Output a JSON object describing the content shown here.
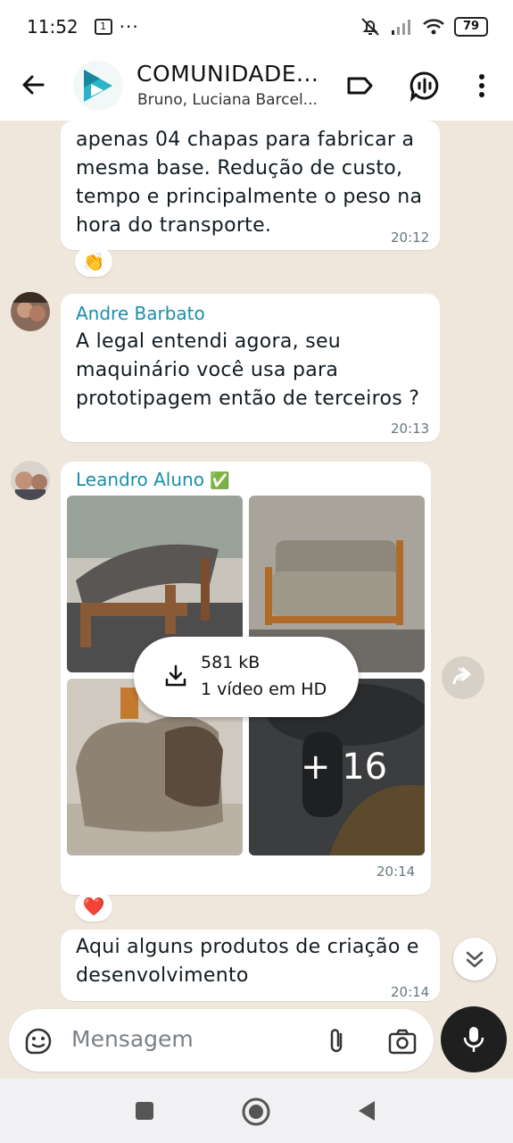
{
  "status_bar": {
    "time": "11:52",
    "notif_count": "1",
    "more": "···",
    "battery": "79"
  },
  "header": {
    "title": "COMUNIDADE...",
    "subtitle": "Bruno, Luciana Barcel..."
  },
  "messages": [
    {
      "text_lines": [
        "apenas 04 chapas para fabricar a",
        "mesma base. Redução de custo,",
        "tempo e principalmente o peso na",
        "hora do transporte."
      ],
      "time": "20:12",
      "reaction": "👏"
    },
    {
      "sender": "Andre Barbato",
      "text_lines": [
        "A legal entendi agora, seu",
        "maquinário você usa para",
        "prototipagem então de terceiros ?"
      ],
      "time": "20:13"
    },
    {
      "sender": "Leandro Aluno",
      "sender_badge": "✅",
      "media": {
        "download_size": "581 kB",
        "download_label": "1 vídeo em HD",
        "more_count": "+ 16"
      },
      "time": "20:14",
      "reaction": "❤️"
    },
    {
      "text_lines": [
        "Aqui alguns produtos de criação e",
        "desenvolvimento"
      ],
      "time": "20:14"
    }
  ],
  "input": {
    "placeholder": "Mensagem"
  },
  "colors": {
    "sender": "#1a8fa8",
    "chat_bg": "#efe7dc",
    "mic_bg": "#1f1f1f"
  },
  "icons": [
    "back-arrow-icon",
    "label-icon",
    "voice-chat-icon",
    "more-vert-icon",
    "forward-icon",
    "scroll-down-icon",
    "sticker-icon",
    "attach-icon",
    "camera-icon",
    "mic-icon",
    "download-icon"
  ]
}
